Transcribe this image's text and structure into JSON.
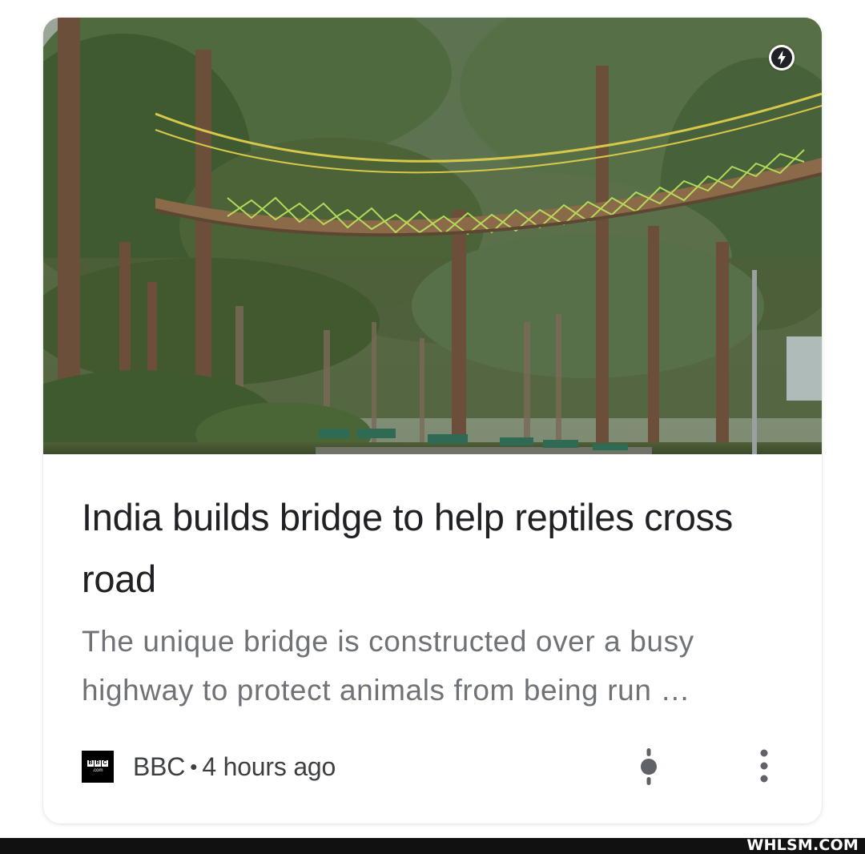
{
  "article": {
    "headline": "India builds bridge to help reptiles cross road",
    "snippet": "The unique bridge is constructed over a busy highway to protect animals from being run …",
    "source": {
      "logo_text": [
        "B",
        "B",
        "C"
      ],
      "logo_subtext": ".com",
      "name": "BBC",
      "separator": "•",
      "time": "4 hours ago"
    },
    "badge_icon": "amp-lightning-icon",
    "image_icon": "forest-rope-bridge-photo"
  },
  "actions": {
    "timeline_icon": "story-timeline-icon",
    "more_icon": "more-vert-icon"
  },
  "watermark": "WHLSM.COM",
  "colors": {
    "headline": "#202124",
    "snippet": "#6f7378",
    "meta": "#3c4043"
  }
}
